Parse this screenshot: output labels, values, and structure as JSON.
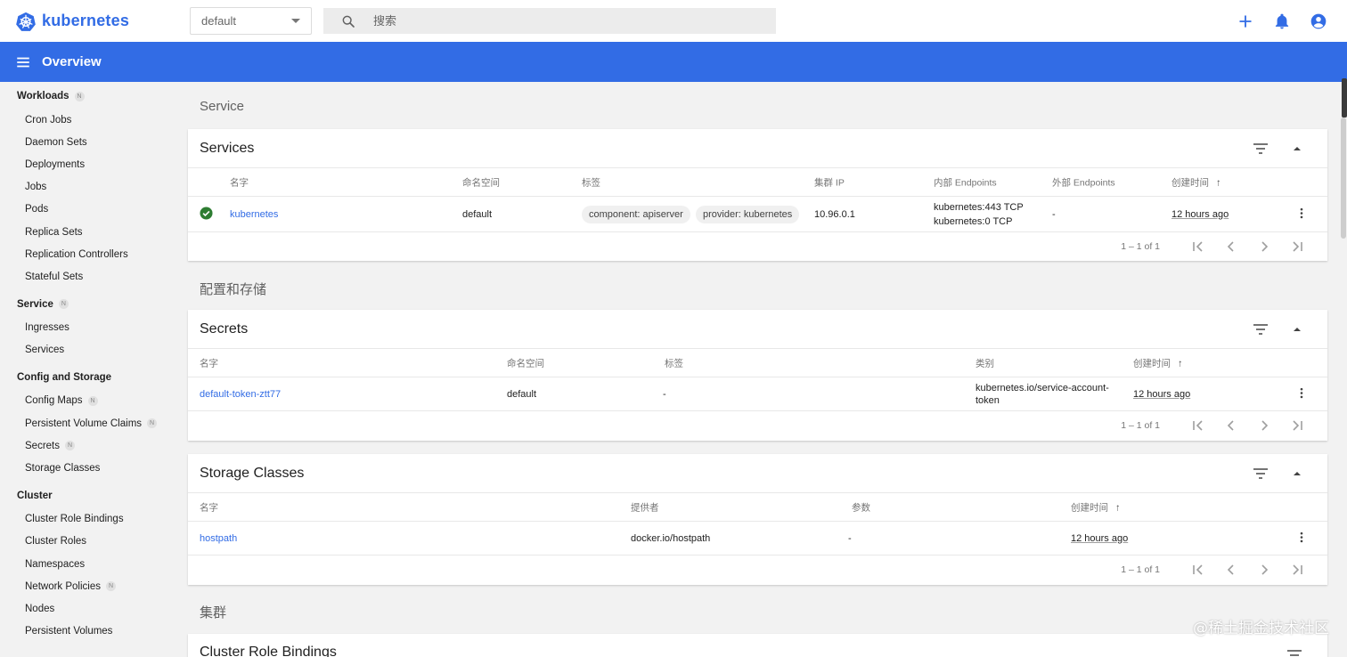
{
  "topbar": {
    "brand": "kubernetes",
    "namespace": "default",
    "search_placeholder": "搜索"
  },
  "toolbar": {
    "title": "Overview"
  },
  "sidebar": {
    "groups": [
      {
        "title": "Workloads",
        "badge": "N",
        "items": [
          {
            "label": "Cron Jobs"
          },
          {
            "label": "Daemon Sets"
          },
          {
            "label": "Deployments"
          },
          {
            "label": "Jobs"
          },
          {
            "label": "Pods"
          },
          {
            "label": "Replica Sets"
          },
          {
            "label": "Replication Controllers"
          },
          {
            "label": "Stateful Sets"
          }
        ]
      },
      {
        "title": "Service",
        "badge": "N",
        "items": [
          {
            "label": "Ingresses"
          },
          {
            "label": "Services"
          }
        ]
      },
      {
        "title": "Config and Storage",
        "badge": "",
        "items": [
          {
            "label": "Config Maps",
            "badge": "N"
          },
          {
            "label": "Persistent Volume Claims",
            "badge": "N"
          },
          {
            "label": "Secrets",
            "badge": "N"
          },
          {
            "label": "Storage Classes"
          }
        ]
      },
      {
        "title": "Cluster",
        "badge": "",
        "items": [
          {
            "label": "Cluster Role Bindings"
          },
          {
            "label": "Cluster Roles"
          },
          {
            "label": "Namespaces"
          },
          {
            "label": "Network Policies",
            "badge": "N"
          },
          {
            "label": "Nodes"
          },
          {
            "label": "Persistent Volumes"
          }
        ]
      }
    ]
  },
  "sections": {
    "service": "Service",
    "config": "配置和存储",
    "cluster": "集群"
  },
  "services_card": {
    "title": "Services",
    "headers": {
      "name": "名字",
      "namespace": "命名空间",
      "labels": "标签",
      "cluster_ip": "集群 IP",
      "internal": "内部 Endpoints",
      "external": "外部 Endpoints",
      "created": "创建时间"
    },
    "row": {
      "name": "kubernetes",
      "namespace": "default",
      "label1": "component: apiserver",
      "label2": "provider: kubernetes",
      "cluster_ip": "10.96.0.1",
      "internal1": "kubernetes:443 TCP",
      "internal2": "kubernetes:0 TCP",
      "external": "-",
      "created": "12 hours ago"
    },
    "pager": "1 – 1 of 1"
  },
  "secrets_card": {
    "title": "Secrets",
    "headers": {
      "name": "名字",
      "namespace": "命名空间",
      "labels": "标签",
      "type": "类别",
      "created": "创建时间"
    },
    "row": {
      "name": "default-token-ztt77",
      "namespace": "default",
      "labels": "-",
      "type1": "kubernetes.io/service-account-",
      "type2": "token",
      "created": "12 hours ago"
    },
    "pager": "1 – 1 of 1"
  },
  "storage_card": {
    "title": "Storage Classes",
    "headers": {
      "name": "名字",
      "provisioner": "提供者",
      "params": "参数",
      "created": "创建时间"
    },
    "row": {
      "name": "hostpath",
      "provisioner": "docker.io/hostpath",
      "params": "-",
      "created": "12 hours ago"
    },
    "pager": "1 – 1 of 1"
  },
  "crb_card": {
    "title": "Cluster Role Bindings"
  },
  "watermark": "@稀土掘金技术社区",
  "colors": {
    "brand": "#326ce5",
    "success": "#2e7d32"
  }
}
